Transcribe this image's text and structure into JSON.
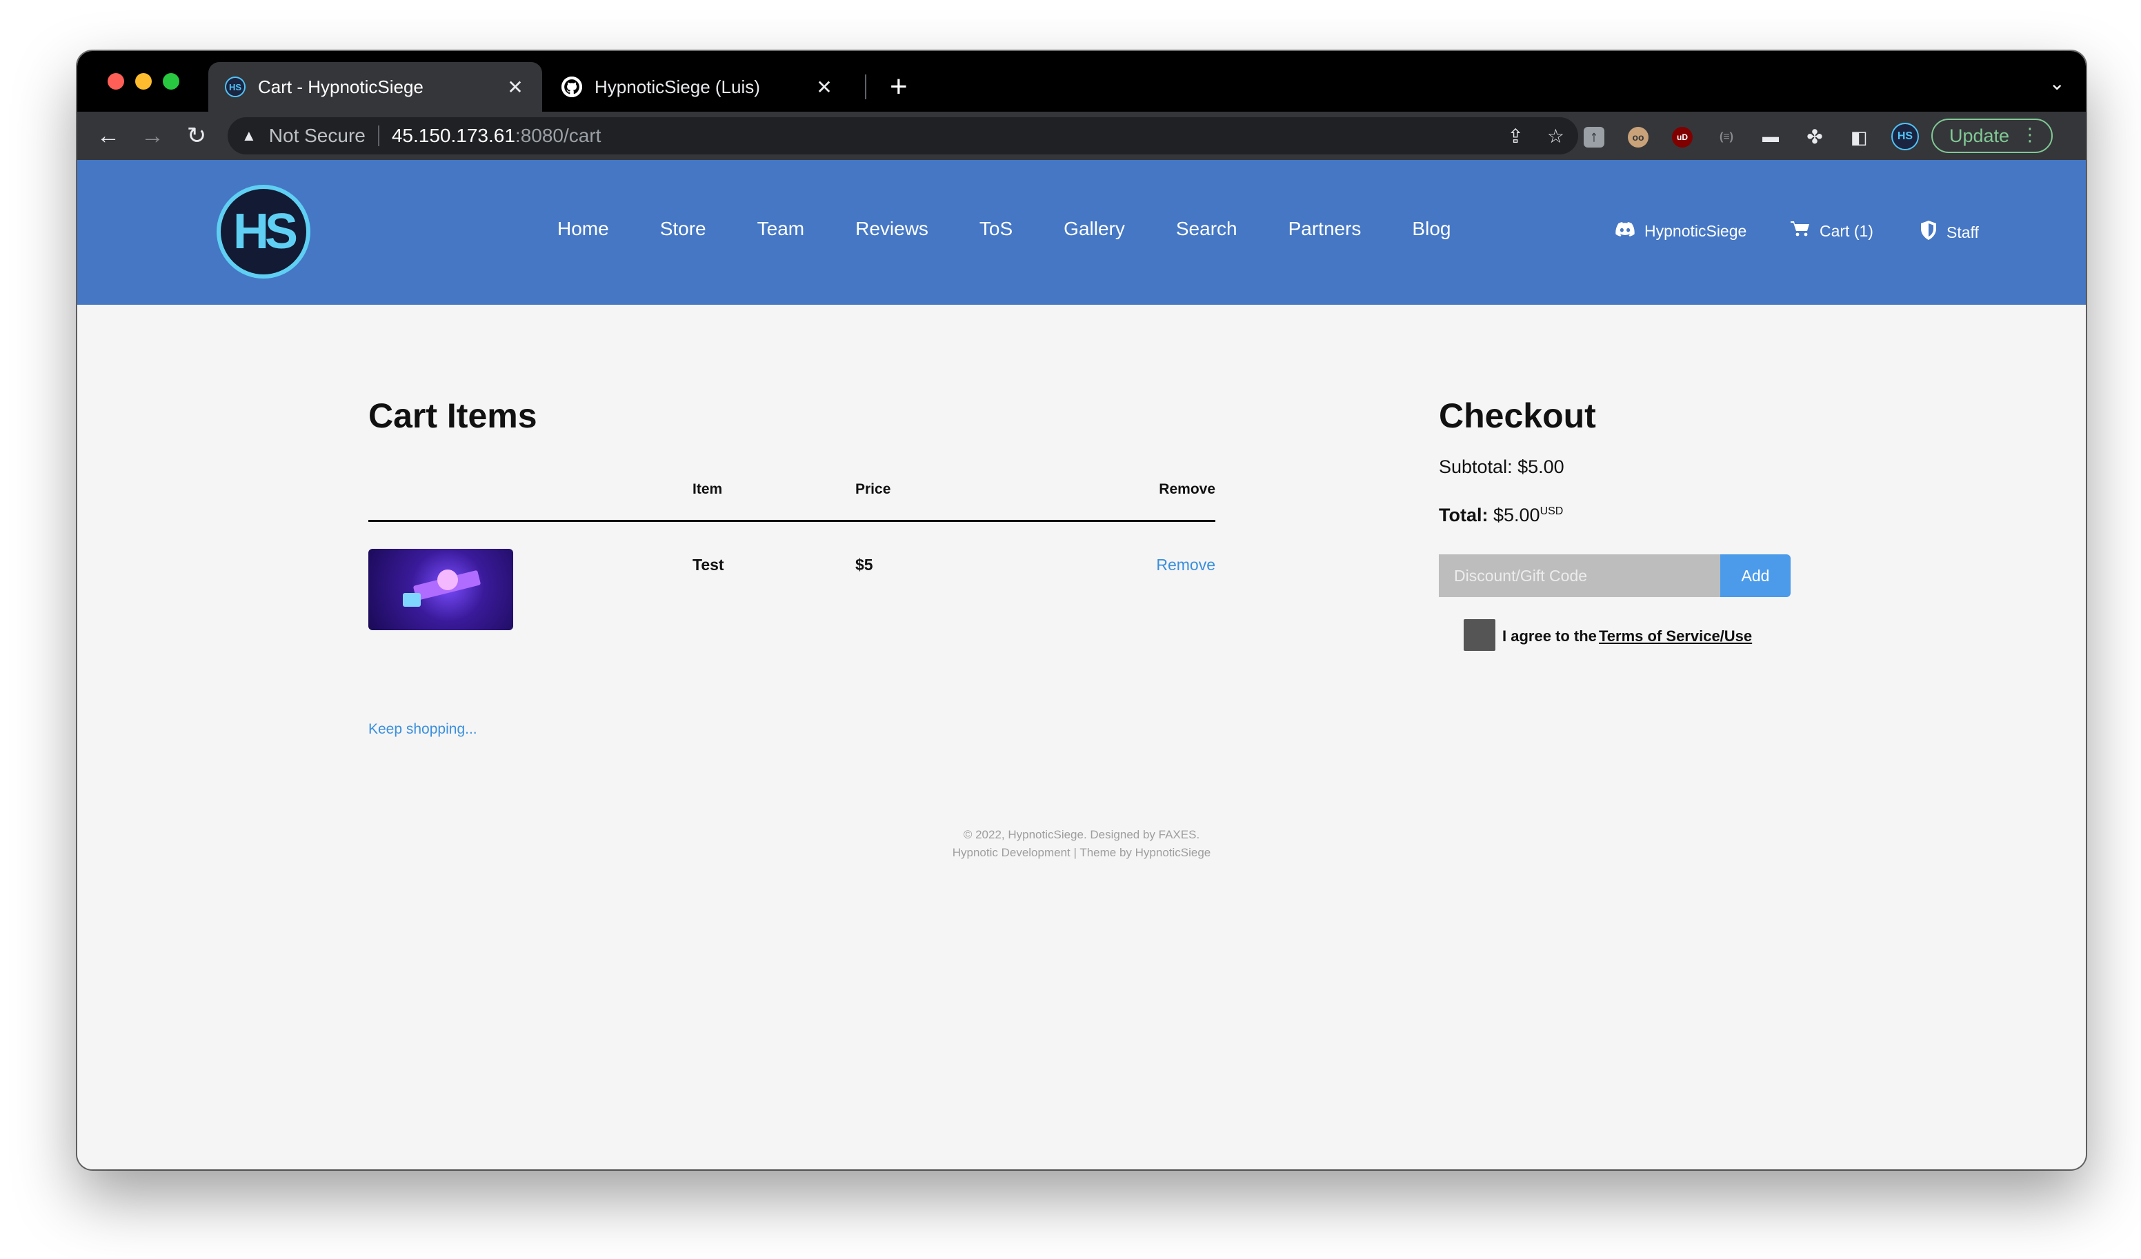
{
  "browser": {
    "tabs": [
      {
        "title": "Cart - HypnoticSiege",
        "favicon": "hypnoticsiege-logo-icon"
      },
      {
        "title": "HypnoticSiege (Luis)",
        "favicon": "github-icon"
      }
    ],
    "tab_close_glyph": "✕",
    "newtab_glyph": "+",
    "address": {
      "security_label": "Not Secure",
      "host": "45.150.173.61",
      "path": ":8080/cart"
    },
    "extensions": [
      {
        "glyph": "ᛏ",
        "name": "extension-icon"
      },
      {
        "glyph": "oo",
        "name": "owl-extension-icon"
      },
      {
        "glyph": "uD",
        "name": "ublock-icon"
      },
      {
        "glyph": "(≡)",
        "name": "extension-icon"
      },
      {
        "glyph": "▬",
        "name": "extension-icon"
      },
      {
        "glyph": "✤",
        "name": "puzzle-icon"
      },
      {
        "glyph": "◧",
        "name": "sidebar-icon"
      }
    ],
    "profile_initials": "HS",
    "update_label": "Update"
  },
  "site": {
    "logo_text": "HS",
    "nav": [
      "Home",
      "Store",
      "Team",
      "Reviews",
      "ToS",
      "Gallery",
      "Search",
      "Partners",
      "Blog"
    ],
    "discord_label": "HypnoticSiege",
    "cart_label": "Cart (1)",
    "staff_label": "Staff"
  },
  "cart": {
    "title": "Cart Items",
    "headers": {
      "item": "Item",
      "price": "Price",
      "remove": "Remove"
    },
    "rows": [
      {
        "item": "Test",
        "price": "$5",
        "remove": "Remove"
      }
    ],
    "keep_shopping": "Keep shopping..."
  },
  "checkout": {
    "title": "Checkout",
    "subtotal_label": "Subtotal:",
    "subtotal_value": "$5.00",
    "total_label": "Total:",
    "total_value": "$5.00",
    "currency": "USD",
    "discount_placeholder": "Discount/Gift Code",
    "add_label": "Add",
    "agree_text": "I agree to the",
    "terms_link": "Terms of Service/Use"
  },
  "footer": {
    "line1": "© 2022, HypnoticSiege. Designed by FAXES.",
    "line2": "Hypnotic Development | Theme by HypnoticSiege"
  },
  "colors": {
    "header_bg": "#4577c4",
    "accent_link": "#3a8fdd",
    "add_button": "#4b9bea",
    "logo_ring": "#5fd0f3"
  }
}
